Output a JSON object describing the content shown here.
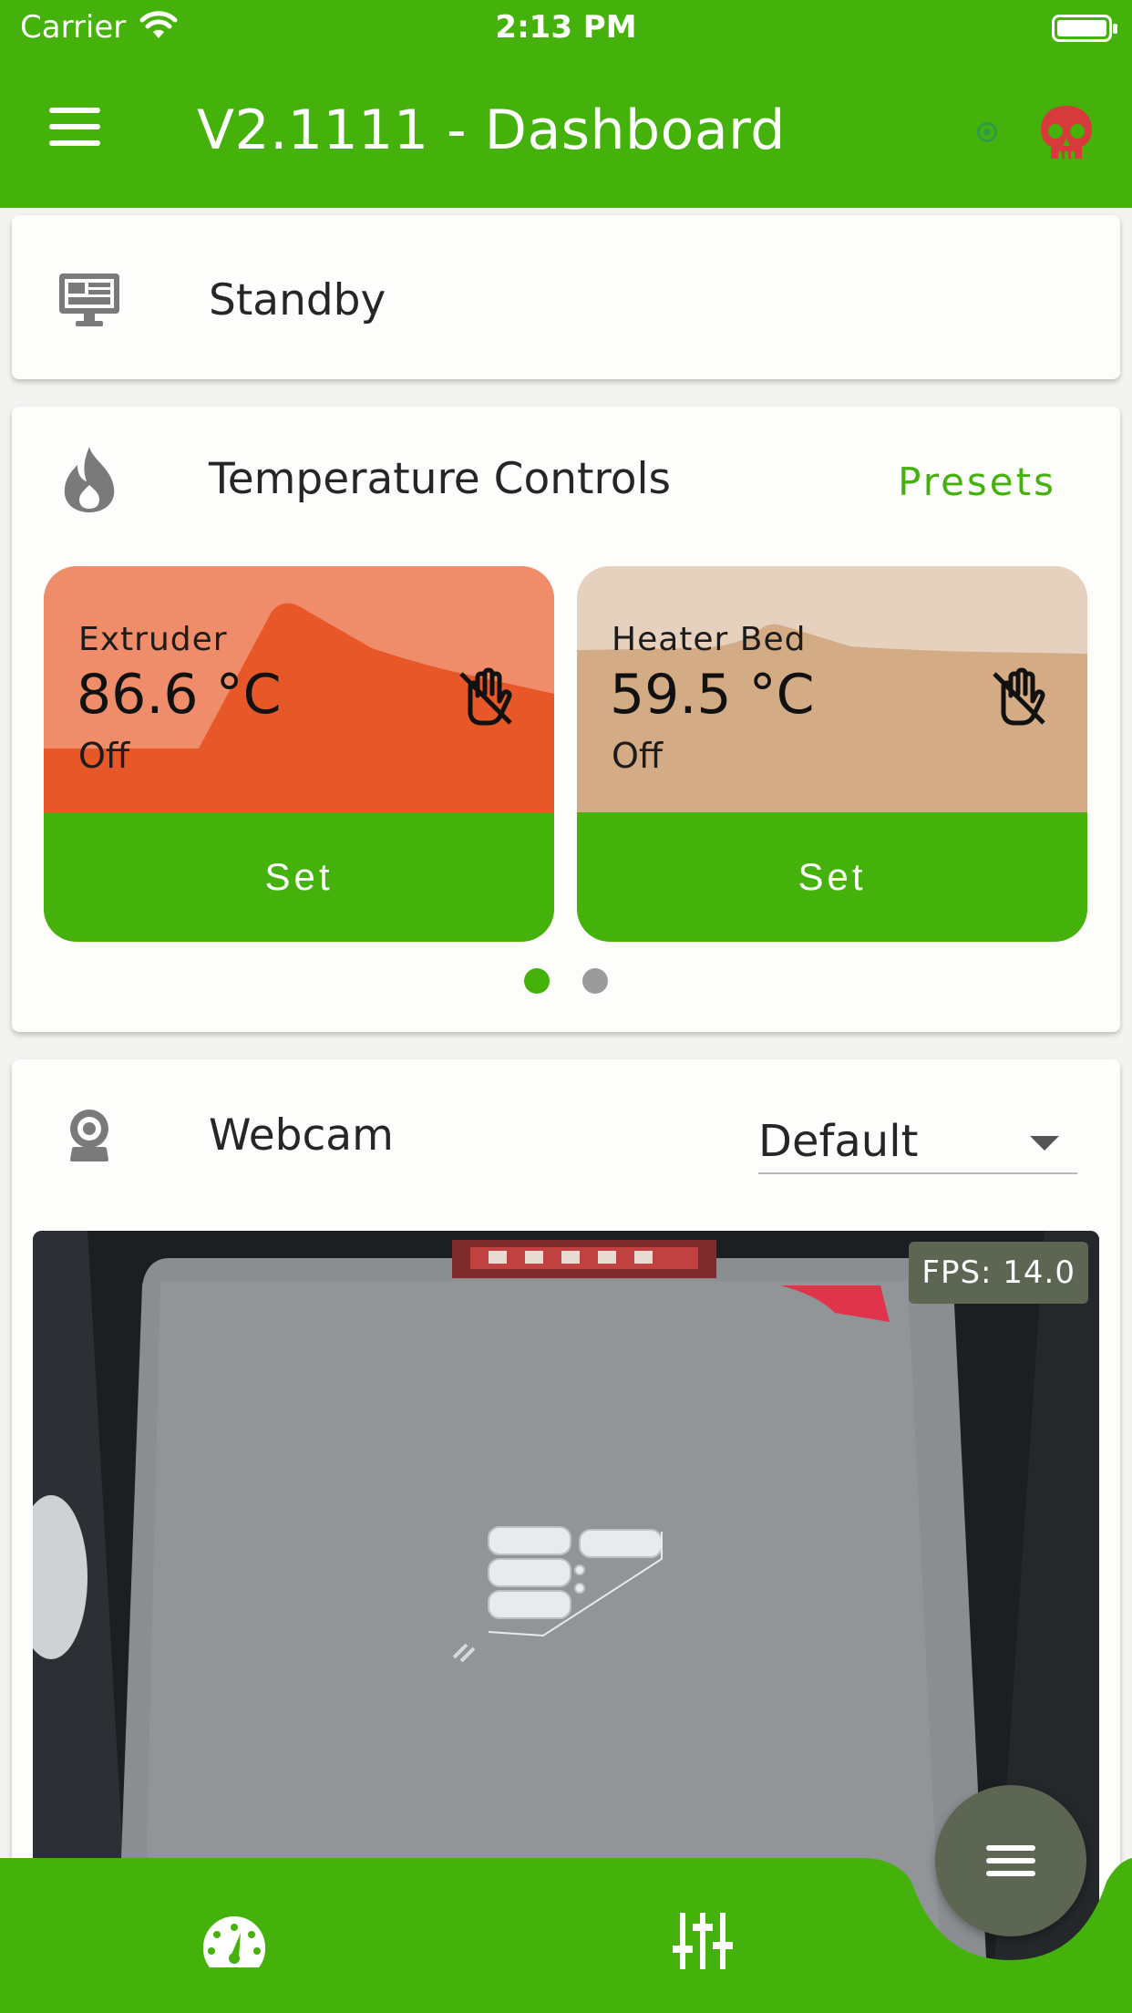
{
  "status_bar": {
    "carrier": "Carrier",
    "time": "2:13 PM"
  },
  "app_bar": {
    "title": "V2.1111 - Dashboard"
  },
  "status_card": {
    "label": "Standby"
  },
  "temperature_card": {
    "title": "Temperature Controls",
    "presets_label": "Presets",
    "heaters": [
      {
        "name": "Extruder",
        "temp": "86.6 °C",
        "state": "Off",
        "button": "Set",
        "color_light": "#ef8d6a",
        "color_dark": "#e85728"
      },
      {
        "name": "Heater Bed",
        "temp": "59.5 °C",
        "state": "Off",
        "button": "Set",
        "color_light": "#e6d0be",
        "color_dark": "#d3ab85"
      }
    ],
    "pages": 2,
    "active_page": 1
  },
  "webcam_card": {
    "title": "Webcam",
    "selected": "Default",
    "fps": "FPS: 14.0"
  },
  "colors": {
    "primary": "#44b20a",
    "fab": "#5c6653",
    "alert_icon": "#d63a3a",
    "connection": "#2d9b48"
  }
}
